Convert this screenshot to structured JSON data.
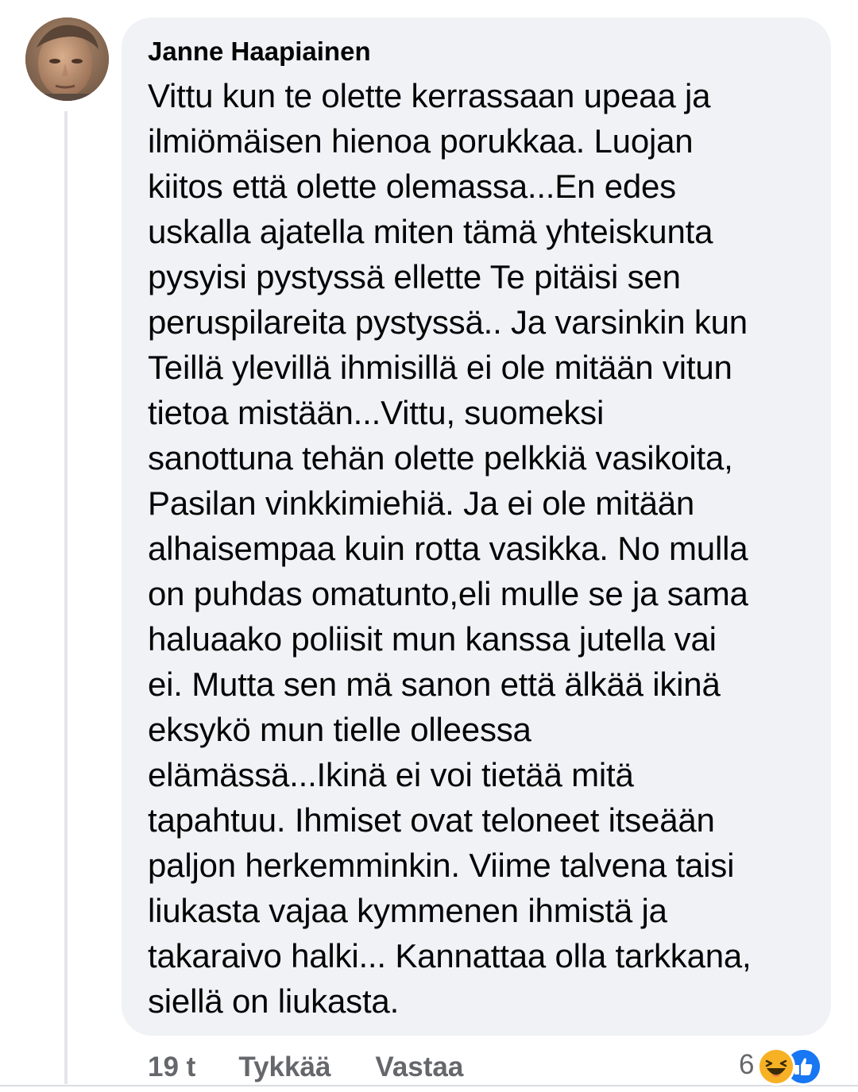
{
  "comment": {
    "author": "Janne Haapiainen",
    "text": "Vittu kun te olette kerrassaan upeaa ja\nilmiömäisen hienoa porukkaa. Luojan\nkiitos että olette olemassa...En edes\nuskalla ajatella miten tämä yhteiskunta\npysyisi pystyssä ellette Te pitäisi sen\nperuspilareita pystyssä.. Ja varsinkin kun\nTeillä ylevillä ihmisillä ei ole mitään vitun\ntietoa mistään...Vittu, suomeksi\nsanottuna tehän olette pelkkiä vasikoita,\nPasilan vinkkimiehiä. Ja ei ole mitään\nalhaisempaa kuin rotta vasikka. No mulla\non puhdas omatunto,eli mulle se ja sama\nhaluaako poliisit mun kanssa jutella vai\nei. Mutta sen mä sanon että älkää ikinä\neksykö mun tielle olleessa\nelämässä...Ikinä ei voi tietää mitä\ntapahtuu. Ihmiset ovat teloneet itseään\npaljon herkemminkin. Viime talvena taisi\nliukasta vajaa kymmenen ihmistä ja\ntakaraivo halki... Kannattaa olla tarkkana,\nsiellä on liukasta."
  },
  "actions": {
    "time": "19 t",
    "like_label": "Tykkää",
    "reply_label": "Vastaa"
  },
  "reactions": {
    "count": "6",
    "icons": [
      "haha-icon",
      "like-icon"
    ]
  },
  "colors": {
    "bubble": "#f0f2f5",
    "text": "#050505",
    "secondary": "#65676b",
    "like_blue": "#1877f2",
    "haha_yellow": "#f7b125"
  }
}
